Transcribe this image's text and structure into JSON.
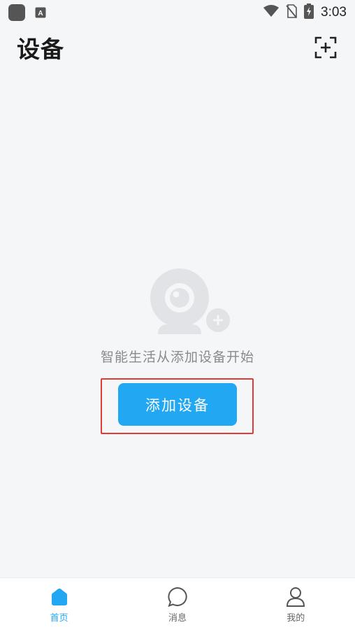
{
  "status_bar": {
    "time": "3:03",
    "icons": [
      "app-icon",
      "a-icon",
      "wifi-icon",
      "no-sim-icon",
      "battery-charging-icon"
    ]
  },
  "header": {
    "title": "设备",
    "action_icon": "scan-add-icon"
  },
  "empty_state": {
    "illustration_icon": "camera-add-icon",
    "message": "智能生活从添加设备开始",
    "button_label": "添加设备"
  },
  "bottom_nav": {
    "items": [
      {
        "label": "首页",
        "icon": "home-icon",
        "active": true
      },
      {
        "label": "消息",
        "icon": "message-icon",
        "active": false
      },
      {
        "label": "我的",
        "icon": "user-icon",
        "active": false
      }
    ]
  },
  "colors": {
    "accent": "#22a7f2",
    "highlight_border": "#e53935",
    "background": "#f5f6f8"
  }
}
